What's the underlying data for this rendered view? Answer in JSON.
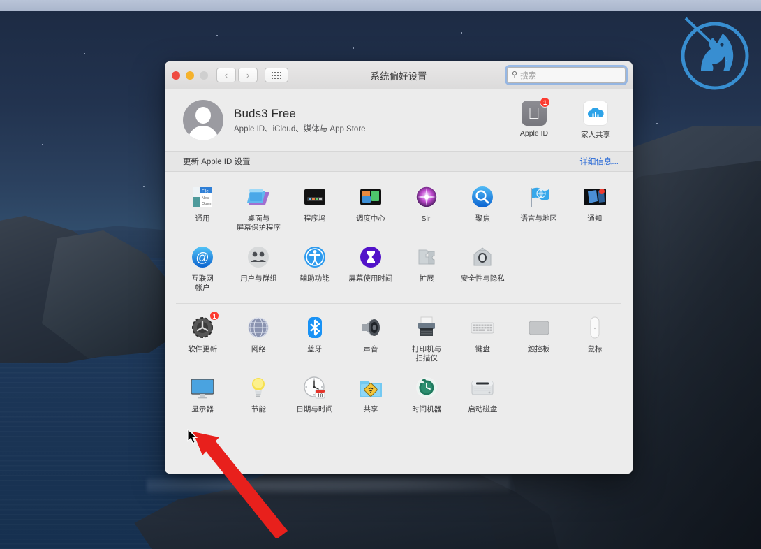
{
  "window": {
    "title": "系统偏好设置",
    "traffic_lights": [
      "close",
      "minimize",
      "zoom"
    ],
    "nav": {
      "back": "‹",
      "forward": "›",
      "grid": "grid-view"
    },
    "search": {
      "placeholder": "搜索",
      "value": "",
      "icon": "search-icon"
    }
  },
  "account": {
    "name": "Buds3 Free",
    "subtitle": "Apple ID、iCloud、媒体与 App Store",
    "avatar_icon": "user-avatar",
    "shortcuts": [
      {
        "label": "Apple ID",
        "icon": "apple-logo-icon",
        "badge": "1"
      },
      {
        "label": "家人共享",
        "icon": "family-sharing-cloud-icon",
        "badge": ""
      }
    ]
  },
  "update_bar": {
    "message": "更新 Apple ID 设置",
    "link": "详细信息..."
  },
  "groups": [
    {
      "name": "personal",
      "rows": [
        [
          {
            "label": "通用",
            "icon": "general-icon"
          },
          {
            "label": "桌面与\n屏幕保护程序",
            "icon": "desktop-screensaver-icon"
          },
          {
            "label": "程序坞",
            "icon": "dock-icon"
          },
          {
            "label": "调度中心",
            "icon": "mission-control-icon"
          },
          {
            "label": "Siri",
            "icon": "siri-icon"
          },
          {
            "label": "聚焦",
            "icon": "spotlight-icon"
          },
          {
            "label": "语言与地区",
            "icon": "language-region-icon"
          },
          {
            "label": "通知",
            "icon": "notifications-icon"
          }
        ],
        [
          {
            "label": "互联网\n帐户",
            "icon": "internet-accounts-icon"
          },
          {
            "label": "用户与群组",
            "icon": "users-groups-icon"
          },
          {
            "label": "辅助功能",
            "icon": "accessibility-icon"
          },
          {
            "label": "屏幕使用时间",
            "icon": "screen-time-icon"
          },
          {
            "label": "扩展",
            "icon": "extensions-icon"
          },
          {
            "label": "安全性与隐私",
            "icon": "security-privacy-icon"
          }
        ]
      ]
    },
    {
      "name": "hardware",
      "rows": [
        [
          {
            "label": "软件更新",
            "icon": "software-update-icon",
            "badge": "1"
          },
          {
            "label": "网络",
            "icon": "network-icon"
          },
          {
            "label": "蓝牙",
            "icon": "bluetooth-icon"
          },
          {
            "label": "声音",
            "icon": "sound-icon"
          },
          {
            "label": "打印机与\n扫描仪",
            "icon": "printers-scanners-icon"
          },
          {
            "label": "键盘",
            "icon": "keyboard-icon"
          },
          {
            "label": "触控板",
            "icon": "trackpad-icon"
          },
          {
            "label": "鼠标",
            "icon": "mouse-icon"
          }
        ],
        [
          {
            "label": "显示器",
            "icon": "displays-icon"
          },
          {
            "label": "节能",
            "icon": "energy-saver-icon"
          },
          {
            "label": "日期与时间",
            "icon": "date-time-icon"
          },
          {
            "label": "共享",
            "icon": "sharing-icon"
          },
          {
            "label": "时间机器",
            "icon": "time-machine-icon"
          },
          {
            "label": "启动磁盘",
            "icon": "startup-disk-icon"
          }
        ]
      ]
    }
  ],
  "annotation": {
    "arrow_color": "#e8201c",
    "points_to": "显示器"
  },
  "desktop": {
    "wallpaper": "catalina-coastline",
    "watermark_icon": "knight-horse-circle-logo"
  },
  "colors": {
    "accent_blue": "#2b6bd6",
    "badge_red": "#fc3b30",
    "window_bg": "#ececec",
    "focus_ring": "#5a96e6"
  }
}
